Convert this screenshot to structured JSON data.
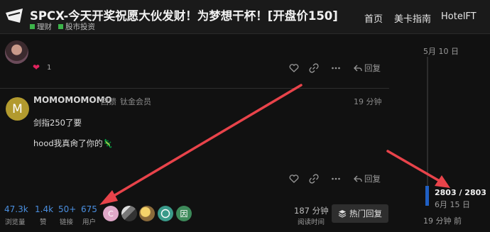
{
  "header": {
    "title": "SPCX-今天开奖祝愿大伙发财！为梦想干杯！[开盘价150]",
    "categories": [
      {
        "label": "理财",
        "color": "#3cb34a"
      },
      {
        "label": "股市投资",
        "color": "#3cb34a"
      }
    ],
    "nav": [
      "首页",
      "美卡指南",
      "HotelFT"
    ]
  },
  "post1": {
    "like_icon": "heart-icon",
    "like_count": "1",
    "reply_label": "回复"
  },
  "post2": {
    "avatar_letter": "M",
    "username": "MOMOMOMOMO",
    "title": "回馈",
    "badge": "钛金会员",
    "time": "19 分钟",
    "lines": [
      "剑指250了要",
      "hood我真肏了你的🦎"
    ],
    "reply_label": "回复"
  },
  "stats": {
    "views": {
      "value": "47.3k",
      "label": "浏览量"
    },
    "likes": {
      "value": "1.4k",
      "label": "赞"
    },
    "links": {
      "value": "50+",
      "label": "链接"
    },
    "users": {
      "value": "675",
      "label": "用户"
    },
    "participant_initials": [
      "C",
      "",
      "",
      "",
      "因"
    ],
    "read_time": "187 分钟",
    "read_label": "阅读时间",
    "hot_replies_label": "热门回复"
  },
  "timeline": {
    "top_date": "5月 10 日",
    "count": "2803 / 2803",
    "current_date": "6月 15 日",
    "bottom_label": "19 分钟 前",
    "accent": "#1f5fc4"
  },
  "colors": {
    "link_blue": "#4a8fe0",
    "annotation_arrow": "#e8434a"
  }
}
